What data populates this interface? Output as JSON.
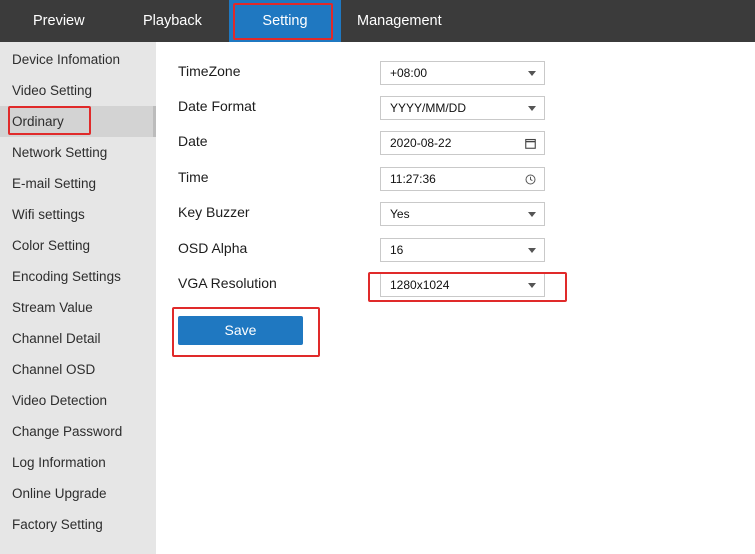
{
  "nav": {
    "tabs": [
      {
        "label": "Preview"
      },
      {
        "label": "Playback"
      },
      {
        "label": "Setting",
        "active": true
      },
      {
        "label": "Management"
      }
    ]
  },
  "sidebar": {
    "items": [
      {
        "label": "Device Infomation"
      },
      {
        "label": "Video Setting"
      },
      {
        "label": "Ordinary",
        "active": true
      },
      {
        "label": "Network Setting"
      },
      {
        "label": "E-mail Setting"
      },
      {
        "label": "Wifi settings"
      },
      {
        "label": "Color Setting"
      },
      {
        "label": "Encoding Settings"
      },
      {
        "label": "Stream Value"
      },
      {
        "label": "Channel Detail"
      },
      {
        "label": "Channel OSD"
      },
      {
        "label": "Video Detection"
      },
      {
        "label": "Change Password"
      },
      {
        "label": "Log Information"
      },
      {
        "label": "Online Upgrade"
      },
      {
        "label": "Factory Setting"
      }
    ]
  },
  "form": {
    "fields": [
      {
        "label": "TimeZone",
        "value": "+08:00",
        "icon": "chevron-down-icon"
      },
      {
        "label": "Date Format",
        "value": "YYYY/MM/DD",
        "icon": "chevron-down-icon"
      },
      {
        "label": "Date",
        "value": "2020-08-22",
        "icon": "calendar-icon"
      },
      {
        "label": "Time",
        "value": "11:27:36",
        "icon": "clock-icon"
      },
      {
        "label": "Key Buzzer",
        "value": "Yes",
        "icon": "chevron-down-icon"
      },
      {
        "label": "OSD Alpha",
        "value": "16",
        "icon": "chevron-down-icon"
      },
      {
        "label": "VGA Resolution",
        "value": "1280x1024",
        "icon": "chevron-down-icon"
      }
    ],
    "save_label": "Save"
  },
  "colors": {
    "nav_bg": "#3b3b3b",
    "accent": "#1f78c1",
    "sidebar_bg": "#e6e6e6",
    "highlight": "#e02a2a"
  }
}
